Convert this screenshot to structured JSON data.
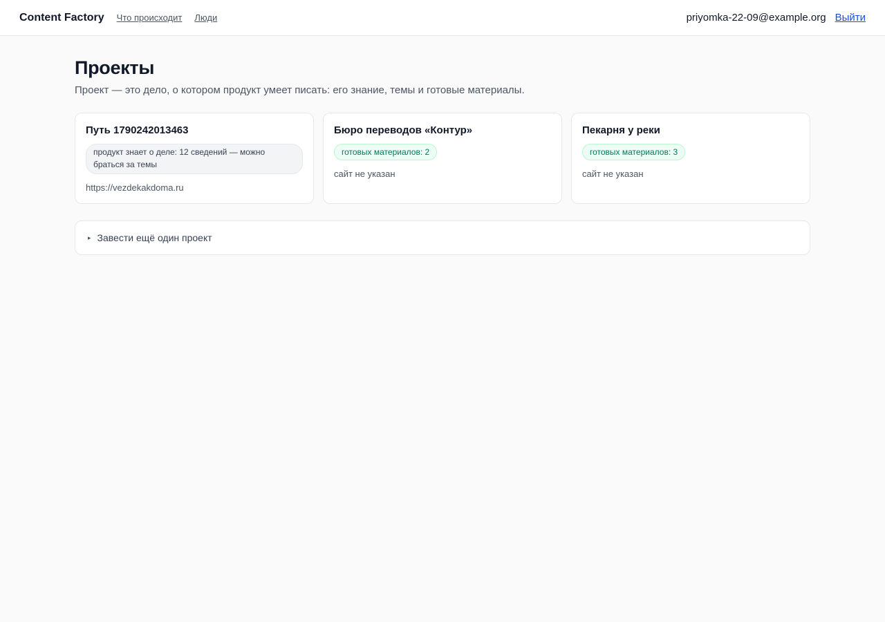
{
  "header": {
    "brand": "Content Factory",
    "nav": [
      {
        "label": "Что происходит"
      },
      {
        "label": "Люди"
      }
    ],
    "user_email": "priyomka-22-09@example.org",
    "logout_label": "Выйти"
  },
  "main": {
    "title": "Проекты",
    "subtitle": "Проект — это дело, о котором продукт умеет писать: его знание, темы и готовые материалы.",
    "projects": [
      {
        "title": "Путь 1790242013463",
        "badge": "продукт знает о деле: 12 сведений — можно браться за темы",
        "badge_kind": "neutral",
        "site": "https://vezdekakdoma.ru"
      },
      {
        "title": "Бюро переводов «Контур»",
        "badge": "готовых материалов: 2",
        "badge_kind": "green",
        "site": "сайт не указан"
      },
      {
        "title": "Пекарня у реки",
        "badge": "готовых материалов: 3",
        "badge_kind": "green",
        "site": "сайт не указан"
      }
    ],
    "add_project": {
      "marker_icon": "triangle-right-icon",
      "label": "Завести ещё один проект"
    }
  }
}
